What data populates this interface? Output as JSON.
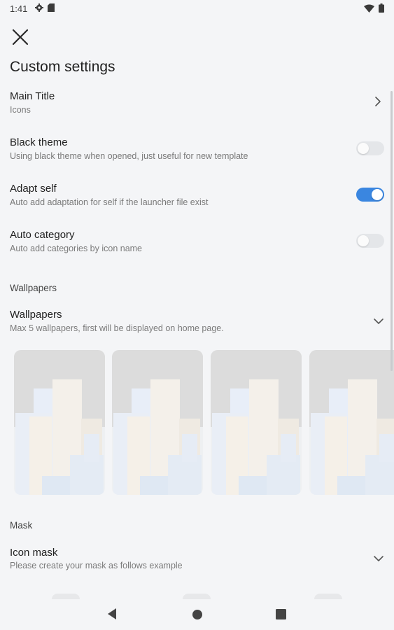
{
  "status_bar": {
    "time": "1:41",
    "left_icons": [
      "gear-icon",
      "sd-card-icon"
    ],
    "right_icons": [
      "wifi-icon",
      "battery-icon"
    ]
  },
  "header": {
    "close_icon": "close-icon",
    "title": "Custom settings"
  },
  "settings": {
    "main_title": {
      "title": "Main Title",
      "subtitle": "Icons"
    },
    "black_theme": {
      "title": "Black theme",
      "subtitle": "Using black theme when opened, just useful for new template",
      "enabled": false
    },
    "adapt_self": {
      "title": "Adapt self",
      "subtitle": "Auto add adaptation for self if the launcher file exist",
      "enabled": true
    },
    "auto_category": {
      "title": "Auto category",
      "subtitle": "Auto add categories by icon name",
      "enabled": false
    }
  },
  "wallpapers_section": {
    "header": "Wallpapers",
    "item": {
      "title": "Wallpapers",
      "subtitle": "Max 5 wallpapers, first will be displayed on home page."
    },
    "thumbnail_count": 4
  },
  "mask_section": {
    "header": "Mask",
    "item": {
      "title": "Icon mask",
      "subtitle": "Please create your mask as follows example"
    }
  },
  "nav_bar": {
    "back_icon": "back-triangle-icon",
    "home_icon": "home-circle-icon",
    "recents_icon": "recents-square-icon"
  },
  "colors": {
    "accent": "#3a86e0",
    "background": "#f4f5f7",
    "toggle_off": "#e4e6e9"
  }
}
